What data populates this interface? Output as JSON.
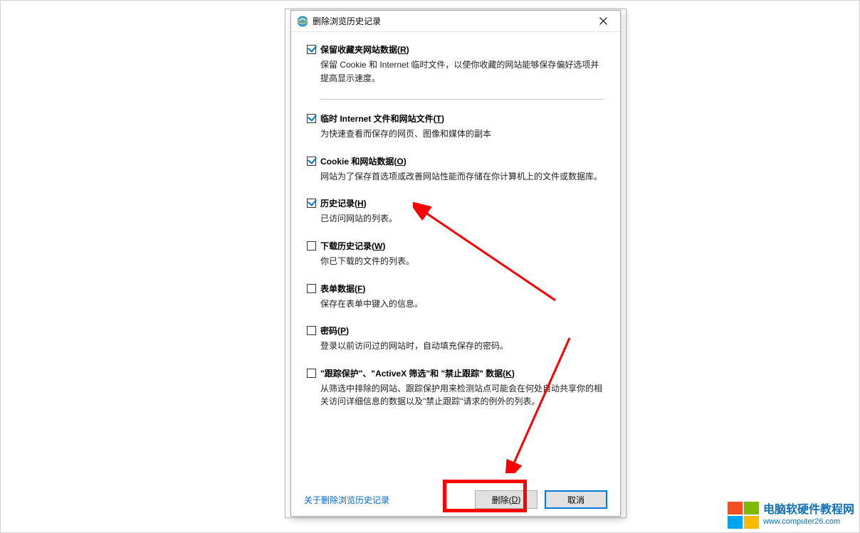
{
  "dialog": {
    "title": "删除浏览历史记录",
    "options": [
      {
        "checked": true,
        "label": "保留收藏夹网站数据(",
        "accel": "R",
        "label_end": ")",
        "desc": "保留 Cookie 和 Internet 临时文件，以使你收藏的网站能够保存偏好选项并提高显示速度。"
      },
      {
        "checked": true,
        "label": "临时 Internet 文件和网站文件(",
        "accel": "T",
        "label_end": ")",
        "desc": "为快速查看而保存的网页、图像和媒体的副本"
      },
      {
        "checked": true,
        "label": "Cookie 和网站数据(",
        "accel": "O",
        "label_end": ")",
        "desc": "网站为了保存首选项或改善网站性能而存储在你计算机上的文件或数据库。"
      },
      {
        "checked": true,
        "label": "历史记录(",
        "accel": "H",
        "label_end": ")",
        "desc": "已访问网站的列表。"
      },
      {
        "checked": false,
        "label": "下载历史记录(",
        "accel": "W",
        "label_end": ")",
        "desc": "你已下载的文件的列表。"
      },
      {
        "checked": false,
        "label": "表单数据(",
        "accel": "F",
        "label_end": ")",
        "desc": "保存在表单中键入的信息。"
      },
      {
        "checked": false,
        "label": "密码(",
        "accel": "P",
        "label_end": ")",
        "desc": "登录以前访问过的网站时，自动填充保存的密码。"
      },
      {
        "checked": false,
        "label": "\"跟踪保护\"、\"ActiveX 筛选\"和 \"禁止跟踪\" 数据(",
        "accel": "K",
        "label_end": ")",
        "desc": "从筛选中排除的网站、跟踪保护用来检测站点可能会在何处自动共享你的相关访问详细信息的数据以及\"禁止跟踪\"请求的例外的列表。"
      }
    ],
    "link": "关于删除浏览历史记录",
    "delete_btn": "删除(",
    "delete_accel": "D",
    "delete_end": ")",
    "cancel_btn": "取消"
  },
  "watermark": {
    "line1": "电脑软硬件教程网",
    "line2": "www.computer26.com"
  }
}
